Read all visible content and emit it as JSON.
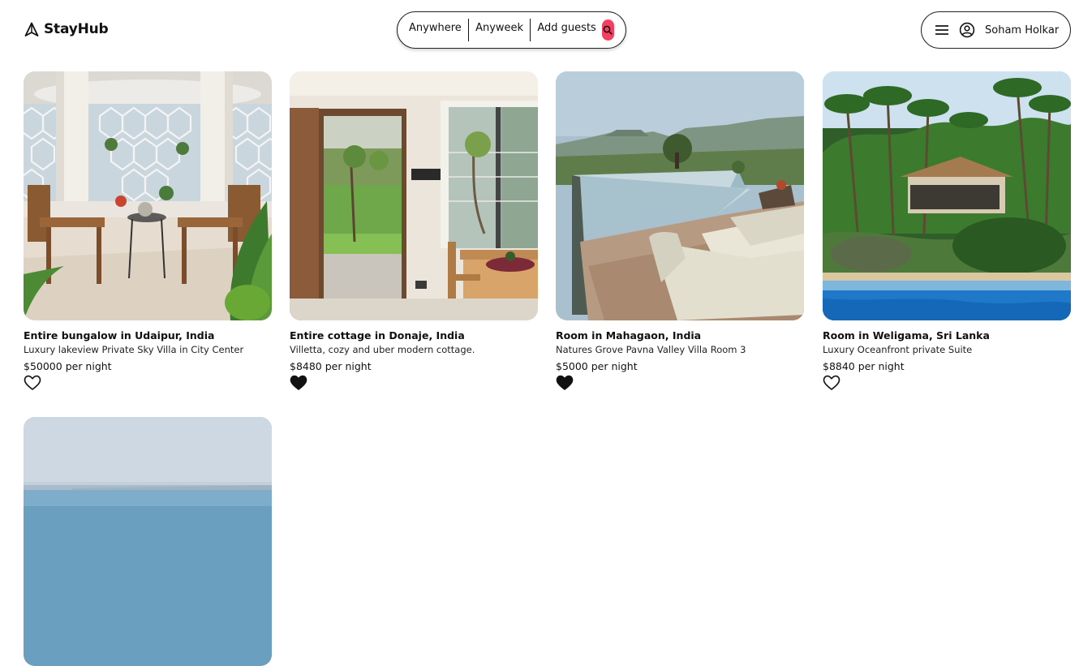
{
  "app": {
    "brand": "StayHub"
  },
  "search": {
    "where": "Anywhere",
    "when": "Anyweek",
    "guests": "Add guests",
    "button_color": "#f43f5e"
  },
  "user": {
    "name": "Soham Holkar",
    "menu_icon": "hamburger-menu-icon",
    "avatar_icon": "user-circle-icon"
  },
  "listings": [
    {
      "title": "Entire bungalow in Udaipur, India",
      "description": "Luxury lakeview Private Sky Villa in City Center",
      "price": "$50000 per night",
      "favorited": false,
      "image": "balcony-villa-photo"
    },
    {
      "title": "Entire cottage in Donaje, India",
      "description": "Villetta, cozy and uber modern cottage.",
      "price": "$8480 per night",
      "favorited": true,
      "image": "cottage-interior-photo"
    },
    {
      "title": "Room in Mahagaon, India",
      "description": "Natures Grove Pavna Valley Villa Room 3",
      "price": "$5000 per night",
      "favorited": true,
      "image": "infinity-pool-photo"
    },
    {
      "title": "Room in Weligama, Sri Lanka",
      "description": "Luxury Oceanfront private Suite",
      "price": "$8840 per night",
      "favorited": false,
      "image": "oceanfront-palms-photo"
    },
    {
      "title": "",
      "description": "",
      "price": "",
      "favorited": false,
      "image": "sea-view-photo"
    }
  ]
}
